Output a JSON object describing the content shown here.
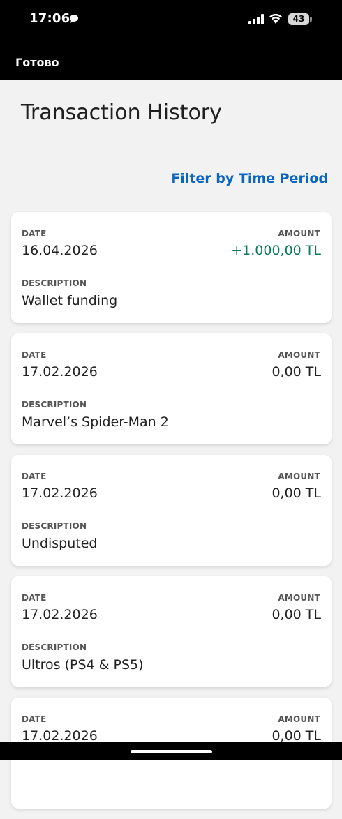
{
  "status_bar": {
    "time": "17:06",
    "battery": "43"
  },
  "nav": {
    "done_label": "Готово"
  },
  "page": {
    "title": "Transaction History",
    "filter_label": "Filter by Time Period"
  },
  "labels": {
    "date": "DATE",
    "amount": "AMOUNT",
    "description": "DESCRIPTION"
  },
  "colors": {
    "positive_amount": "#0f7b55",
    "link": "#0a66c2"
  },
  "transactions": [
    {
      "date": "16.04.2026",
      "amount": "+1.000,00 TL",
      "description": "Wallet funding"
    },
    {
      "date": "17.02.2026",
      "amount": "0,00 TL",
      "description": "Marvel’s Spider-Man 2"
    },
    {
      "date": "17.02.2026",
      "amount": "0,00 TL",
      "description": "Undisputed"
    },
    {
      "date": "17.02.2026",
      "amount": "0,00 TL",
      "description": "Ultros (PS4 & PS5)"
    },
    {
      "date": "17.02.2026",
      "amount": "0,00 TL",
      "description": ""
    }
  ]
}
